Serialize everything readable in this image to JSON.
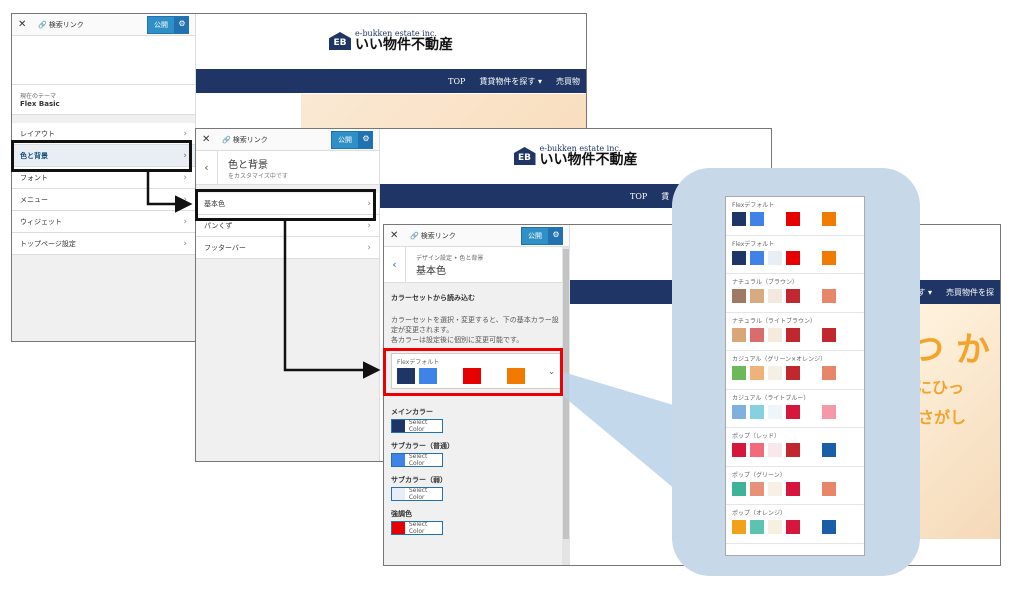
{
  "windows": {
    "w1": {
      "toolbar": {
        "link_label": "検索リンク",
        "publish": "公開"
      },
      "theme_label": "現在のテーマ",
      "theme_name": "Flex Basic",
      "menu": [
        {
          "label": "レイアウト"
        },
        {
          "label": "色と背景"
        },
        {
          "label": "フォント"
        },
        {
          "label": "メニュー"
        },
        {
          "label": "ウィジェット"
        },
        {
          "label": "トップページ設定"
        }
      ]
    },
    "w2": {
      "toolbar": {
        "link_label": "検索リンク",
        "publish": "公開"
      },
      "title": "色と背景",
      "subtitle": "をカスタマイズ中です",
      "menu": [
        {
          "label": "基本色"
        },
        {
          "label": "パンくず"
        },
        {
          "label": "フッターバー"
        }
      ]
    },
    "w3": {
      "toolbar": {
        "link_label": "検索リンク",
        "publish": "公開"
      },
      "breadcrumb": "デザイン設定 • 色と背景",
      "title": "基本色",
      "section_title": "カラーセットから読み込む",
      "desc1": "カラーセットを選択・変更すると、下の基本カラー設定が変更されます。",
      "desc2": "各カラーは設定後に個別に変更可能です。",
      "selected_set": "Flexデフォルト",
      "selected_colors": [
        "#1f3566",
        "#3f82e8",
        "#ffffff",
        "#e60000",
        "#ffffff",
        "#f17a00"
      ],
      "color_fields": [
        {
          "label": "メインカラー",
          "color": "#1f3566",
          "button": "Select Color"
        },
        {
          "label": "サブカラー（普通）",
          "color": "#3f82e8",
          "button": "Select Color"
        },
        {
          "label": "サブカラー（弱）",
          "color": "#e8eef6",
          "button": "Select Color"
        },
        {
          "label": "強調色",
          "color": "#e60000",
          "button": "Select Color"
        }
      ]
    }
  },
  "site": {
    "logo_initials": "EB",
    "logo_en": "e-bukken estate inc.",
    "logo_jp": "いい物件不動産",
    "nav": [
      "TOP",
      "賃貸物件を探す ▾",
      "売買物"
    ],
    "nav_w2": [
      "TOP",
      "賃"
    ],
    "nav_w3": [
      "す ▾",
      "売買物件を探"
    ],
    "hero_w3_1": "つ か",
    "hero_w3_2": "たにひっ",
    "hero_w3_3": "さがし"
  },
  "color_sets": [
    {
      "name": "Flexデフォルト",
      "colors": [
        "#1f3566",
        "#3f82e8",
        "#ffffff",
        "#e60000",
        "#ffffff",
        "#f17a00"
      ]
    },
    {
      "name": "Flexデフォルト",
      "colors": [
        "#1f3566",
        "#3f82e8",
        "#e8eef6",
        "#e60000",
        "#ffffff",
        "#f17a00"
      ]
    },
    {
      "name": "ナチュラル（ブラウン）",
      "colors": [
        "#9c7b62",
        "#d9a982",
        "#f4e8dc",
        "#c0282d",
        "#ffffff",
        "#e8866a"
      ]
    },
    {
      "name": "ナチュラル（ライトブラウン）",
      "colors": [
        "#d9a67a",
        "#d96c6c",
        "#f6eadf",
        "#c0282d",
        "#ffffff",
        "#c0282d"
      ]
    },
    {
      "name": "カジュアル（グリーン×オレンジ）",
      "colors": [
        "#6cb85a",
        "#efb27a",
        "#f4f0e4",
        "#c0282d",
        "#ffffff",
        "#e8866a"
      ]
    },
    {
      "name": "カジュアル（ライトブルー）",
      "colors": [
        "#7fb0e0",
        "#86d1df",
        "#eef5fb",
        "#d7163c",
        "#ffffff",
        "#f599a8"
      ]
    },
    {
      "name": "ポップ（レッド）",
      "colors": [
        "#d7163c",
        "#f36a7a",
        "#f8e8eb",
        "#c0282d",
        "#ffffff",
        "#1a5ea8"
      ]
    },
    {
      "name": "ポップ（グリーン）",
      "colors": [
        "#3fb29a",
        "#e8917a",
        "#f6f0e6",
        "#d7163c",
        "#ffffff",
        "#e8866a"
      ]
    },
    {
      "name": "ポップ（オレンジ）",
      "colors": [
        "#f2a21a",
        "#5cc3b0",
        "#f7efe0",
        "#d7163c",
        "#ffffff",
        "#1a5ea8"
      ]
    }
  ]
}
